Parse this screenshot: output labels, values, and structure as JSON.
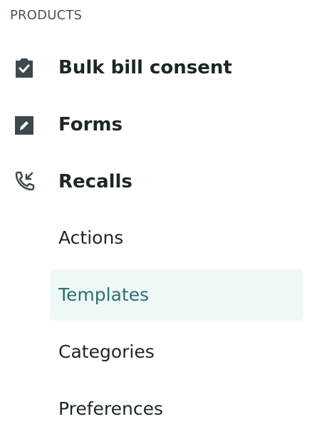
{
  "section": {
    "title": "PRODUCTS"
  },
  "products": [
    {
      "label": "Bulk bill consent",
      "icon": "clipboard-check-icon"
    },
    {
      "label": "Forms",
      "icon": "edit-form-icon"
    },
    {
      "label": "Recalls",
      "icon": "phone-incoming-icon"
    }
  ],
  "recalls_submenu": [
    {
      "label": "Actions",
      "active": false
    },
    {
      "label": "Templates",
      "active": true
    },
    {
      "label": "Categories",
      "active": false
    },
    {
      "label": "Preferences",
      "active": false
    }
  ],
  "colors": {
    "icon": "#3c4a4e",
    "text": "#1d2628",
    "active_text": "#2f6f73",
    "active_bg": "#eef8f7"
  }
}
